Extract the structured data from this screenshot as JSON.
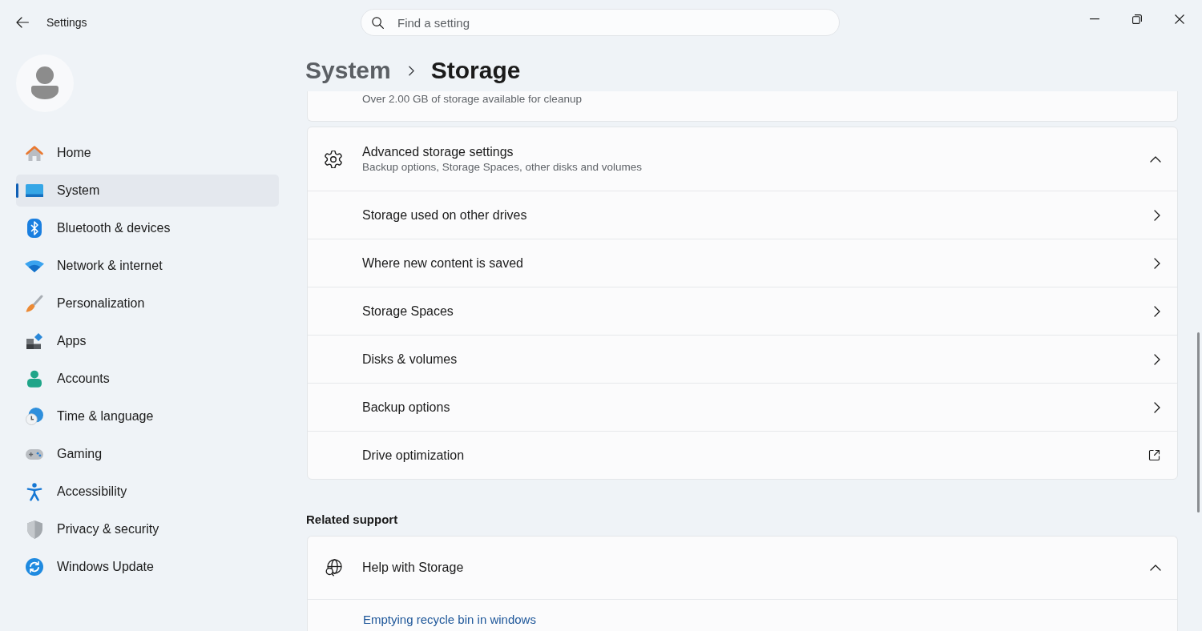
{
  "window": {
    "title": "Settings"
  },
  "search": {
    "placeholder": "Find a setting"
  },
  "sidebar": {
    "items": [
      {
        "label": "Home",
        "selected": false
      },
      {
        "label": "System",
        "selected": true
      },
      {
        "label": "Bluetooth & devices",
        "selected": false
      },
      {
        "label": "Network & internet",
        "selected": false
      },
      {
        "label": "Personalization",
        "selected": false
      },
      {
        "label": "Apps",
        "selected": false
      },
      {
        "label": "Accounts",
        "selected": false
      },
      {
        "label": "Time & language",
        "selected": false
      },
      {
        "label": "Gaming",
        "selected": false
      },
      {
        "label": "Accessibility",
        "selected": false
      },
      {
        "label": "Privacy & security",
        "selected": false
      },
      {
        "label": "Windows Update",
        "selected": false
      }
    ]
  },
  "breadcrumb": {
    "parent": "System",
    "current": "Storage"
  },
  "cleanup": {
    "description": "Over 2.00 GB of storage available for cleanup"
  },
  "advanced": {
    "title": "Advanced storage settings",
    "description": "Backup options, Storage Spaces, other disks and volumes",
    "expanded": true,
    "rows": [
      {
        "label": "Storage used on other drives",
        "kind": "navigate"
      },
      {
        "label": "Where new content is saved",
        "kind": "navigate"
      },
      {
        "label": "Storage Spaces",
        "kind": "navigate"
      },
      {
        "label": "Disks & volumes",
        "kind": "navigate"
      },
      {
        "label": "Backup options",
        "kind": "navigate"
      },
      {
        "label": "Drive optimization",
        "kind": "external"
      }
    ]
  },
  "related_support": {
    "heading": "Related support",
    "title": "Help with Storage",
    "expanded": true,
    "links": [
      "Emptying recycle bin in windows"
    ]
  }
}
